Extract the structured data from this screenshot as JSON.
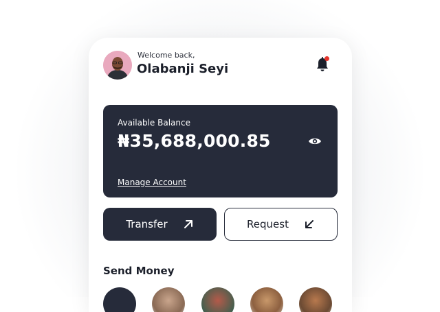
{
  "header": {
    "welcome_text": "Welcome back,",
    "user_name": "Olabanji Seyi"
  },
  "balance": {
    "label": "Available Balance",
    "amount": "₦35,688,000.85",
    "manage_link": "Manage Account"
  },
  "actions": {
    "transfer_label": "Transfer",
    "request_label": "Request"
  },
  "send_money": {
    "title": "Send Money"
  },
  "colors": {
    "primary_dark": "#262b3a",
    "notification_dot": "#e5342c",
    "avatar_bg": "#e8a8bc"
  },
  "icons": [
    "bell-icon",
    "eye-icon",
    "arrow-up-right-icon",
    "arrow-down-left-icon"
  ]
}
